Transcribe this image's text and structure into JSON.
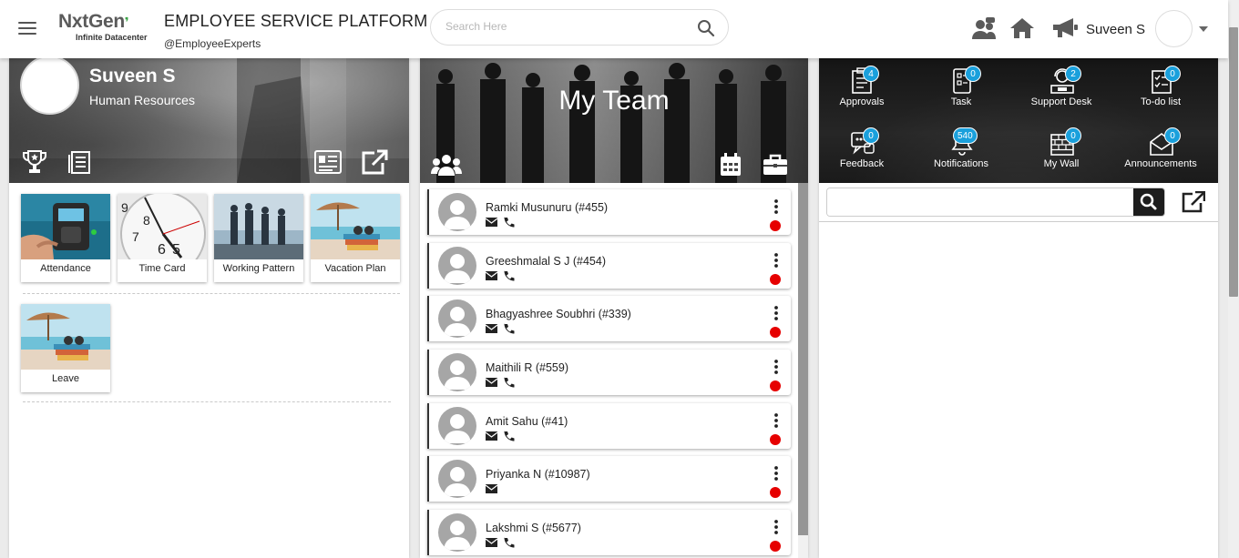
{
  "header": {
    "logo_text": "NxtGen",
    "logo_subtext": "Infinite Datacenter",
    "title": "EMPLOYEE SERVICE PLATFORM",
    "handle": "@EmployeeExperts",
    "search_placeholder": "Search Here",
    "user_name": "Suveen S"
  },
  "profile": {
    "name": "Suveen S",
    "department": "Human Resources"
  },
  "tiles": [
    {
      "label": "Attendance"
    },
    {
      "label": "Time Card"
    },
    {
      "label": "Working Pattern"
    },
    {
      "label": "Vacation Plan"
    },
    {
      "label": "Leave"
    }
  ],
  "team": {
    "title": "My Team",
    "members": [
      {
        "name": "Ramki Musunuru (#455)",
        "has_email": true,
        "has_phone": true,
        "status_color": "#e60000"
      },
      {
        "name": "Greeshmalal S J (#454)",
        "has_email": true,
        "has_phone": true,
        "status_color": "#e60000"
      },
      {
        "name": "Bhagyashree Soubhri (#339)",
        "has_email": true,
        "has_phone": true,
        "status_color": "#e60000"
      },
      {
        "name": "Maithili R (#559)",
        "has_email": true,
        "has_phone": true,
        "status_color": "#e60000"
      },
      {
        "name": "Amit Sahu (#41)",
        "has_email": true,
        "has_phone": true,
        "status_color": "#e60000"
      },
      {
        "name": "Priyanka N (#10987)",
        "has_email": true,
        "has_phone": false,
        "status_color": "#e60000"
      },
      {
        "name": "Lakshmi S (#5677)",
        "has_email": true,
        "has_phone": true,
        "status_color": "#e60000"
      }
    ]
  },
  "widgets": [
    {
      "label": "Approvals",
      "count": "4",
      "icon": "approvals-icon"
    },
    {
      "label": "Task",
      "count": "0",
      "icon": "task-icon"
    },
    {
      "label": "Support Desk",
      "count": "2",
      "icon": "support-desk-icon"
    },
    {
      "label": "To-do list",
      "count": "0",
      "icon": "todo-list-icon"
    },
    {
      "label": "Feedback",
      "count": "0",
      "icon": "feedback-icon"
    },
    {
      "label": "Notifications",
      "count": "540",
      "icon": "notifications-icon"
    },
    {
      "label": "My Wall",
      "count": "0",
      "icon": "my-wall-icon"
    },
    {
      "label": "Announcements",
      "count": "0",
      "icon": "announcements-icon"
    }
  ],
  "colors": {
    "accent_badge": "#1aa0dc",
    "status_offline": "#e60000",
    "logo_green": "#3aa346"
  }
}
